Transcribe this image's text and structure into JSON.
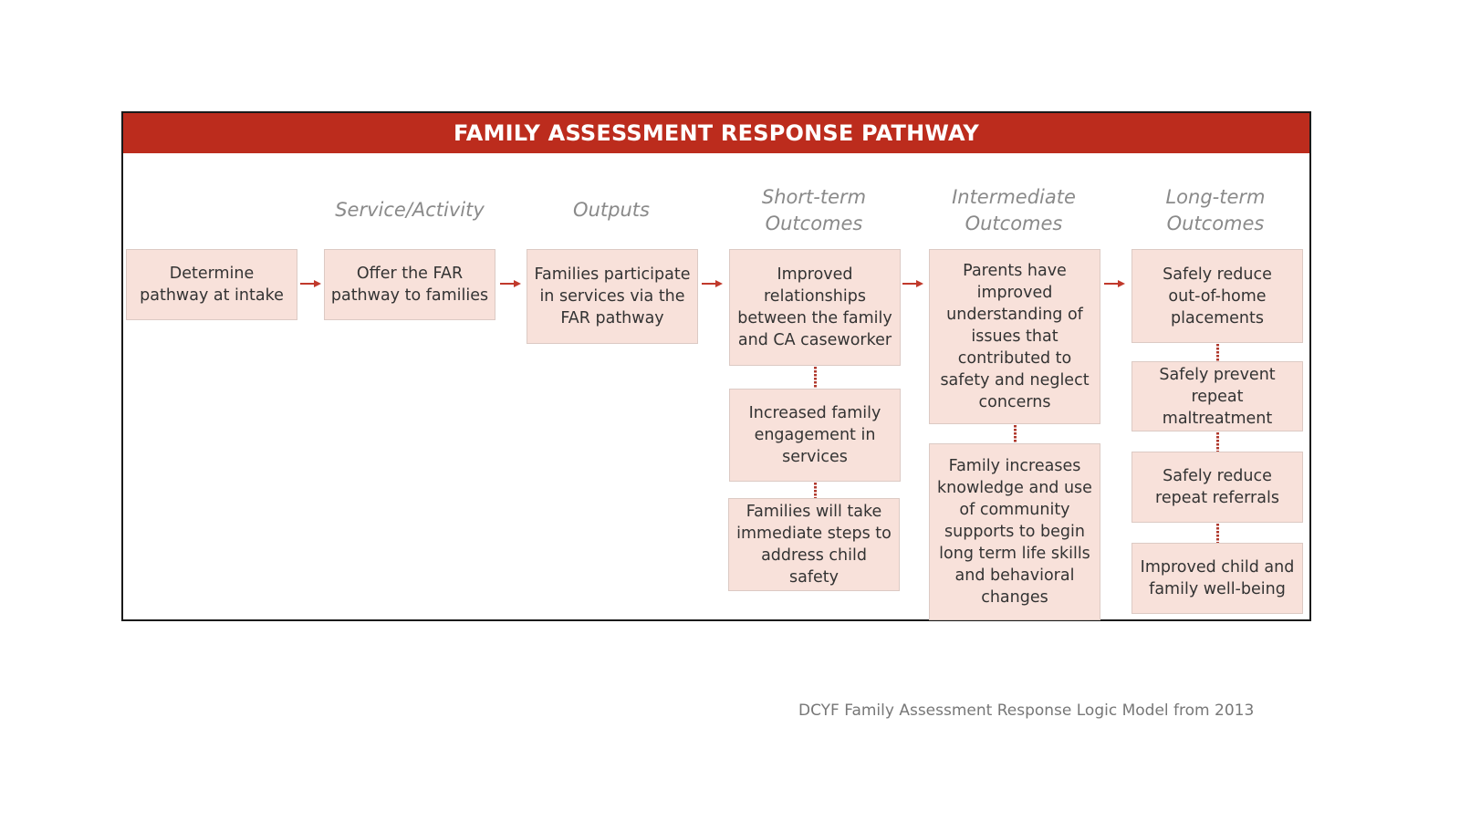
{
  "title": "FAMILY ASSESSMENT RESPONSE PATHWAY",
  "colors": {
    "banner": "#bc2c1d",
    "box_fill": "#f8e1da",
    "arrow": "#c0392b",
    "heading_text": "#8a8a8a"
  },
  "columns": [
    {
      "heading": "",
      "boxes": [
        "Determine\npathway at intake"
      ]
    },
    {
      "heading": "Service/Activity",
      "boxes": [
        "Offer the FAR\npathway to families"
      ]
    },
    {
      "heading": "Outputs",
      "boxes": [
        "Families participate\nin services via the\nFAR pathway"
      ]
    },
    {
      "heading": "Short-term\nOutcomes",
      "boxes": [
        "Improved\nrelationships\nbetween the family\nand CA caseworker",
        "Increased family\nengagement in\nservices",
        "Families will take\nimmediate steps to\naddress child safety"
      ]
    },
    {
      "heading": "Intermediate\nOutcomes",
      "boxes": [
        "Parents have\nimproved\nunderstanding of\nissues that\ncontributed to\nsafety and neglect\nconcerns",
        "Family increases\nknowledge and use\nof community\nsupports to begin\nlong term life skills\nand behavioral\nchanges"
      ]
    },
    {
      "heading": "Long-term\nOutcomes",
      "boxes": [
        "Safely reduce\nout-of-home\nplacements",
        "Safely prevent\nrepeat maltreatment",
        "Safely reduce\nrepeat referrals",
        "Improved child and\nfamily well-being"
      ]
    }
  ],
  "caption": "DCYF Family Assessment Response Logic Model from 2013"
}
